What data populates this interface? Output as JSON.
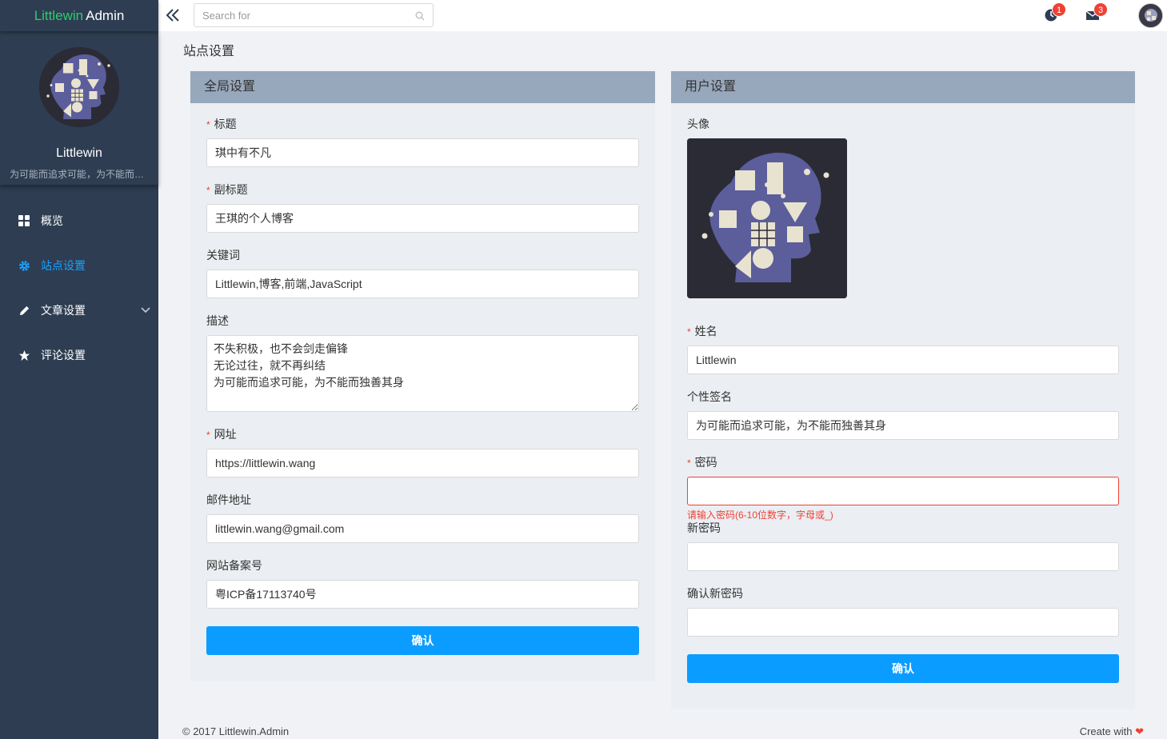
{
  "brand": {
    "part1": "Littlewin",
    "part2": "Admin"
  },
  "profile": {
    "name": "Littlewin",
    "signature": "为可能而追求可能，为不能而独善其身"
  },
  "menu": [
    {
      "label": "概览",
      "icon": "dashboard-icon"
    },
    {
      "label": "站点设置",
      "icon": "gear-icon",
      "active": true
    },
    {
      "label": "文章设置",
      "icon": "pencil-icon",
      "expandable": true
    },
    {
      "label": "评论设置",
      "icon": "star-icon"
    }
  ],
  "topbar": {
    "search_placeholder": "Search for",
    "notifications": {
      "icon": "clock-icon",
      "count": "1"
    },
    "messages": {
      "icon": "mail-icon",
      "count": "3"
    }
  },
  "page": {
    "title": "站点设置"
  },
  "global": {
    "title": "全局设置",
    "fields": {
      "title": {
        "label": "标题",
        "value": "琪中有不凡",
        "required": true
      },
      "subtitle": {
        "label": "副标题",
        "value": "王琪的个人博客",
        "required": true
      },
      "keywords": {
        "label": "关键词",
        "value": "Littlewin,博客,前端,JavaScript"
      },
      "description": {
        "label": "描述",
        "value": "不失积极，也不会剑走偏锋\n无论过往，就不再纠结\n为可能而追求可能，为不能而独善其身"
      },
      "url": {
        "label": "网址",
        "value": "https://littlewin.wang",
        "required": true
      },
      "email": {
        "label": "邮件地址",
        "value": "littlewin.wang@gmail.com"
      },
      "icp": {
        "label": "网站备案号",
        "value": "粤ICP备17113740号"
      }
    },
    "submit": "确认"
  },
  "user": {
    "title": "用户设置",
    "fields": {
      "avatar": {
        "label": "头像"
      },
      "name": {
        "label": "姓名",
        "value": "Littlewin",
        "required": true
      },
      "signature": {
        "label": "个性签名",
        "value": "为可能而追求可能，为不能而独善其身"
      },
      "password": {
        "label": "密码",
        "value": "",
        "required": true,
        "error": "请输入密码(6-10位数字，字母或_)"
      },
      "new_password": {
        "label": "新密码",
        "value": ""
      },
      "confirm_password": {
        "label": "确认新密码",
        "value": ""
      }
    },
    "submit": "确认"
  },
  "footer": {
    "copyright": "© 2017 Littlewin.Admin",
    "credit": "Create with",
    "heart": "❤"
  },
  "colors": {
    "sidebar": "#2e3d52",
    "accent": "#1aa1ff",
    "button": "#0a9dff",
    "panel_head": "#97a7bc",
    "error": "#f04134",
    "brand_green": "#2ecc71"
  }
}
